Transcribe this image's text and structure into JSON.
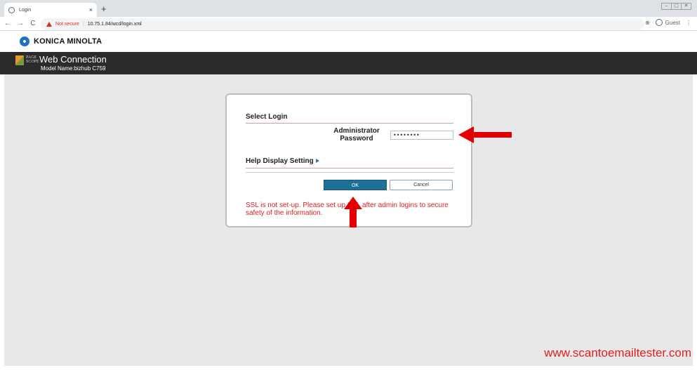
{
  "browser": {
    "tab_title": "Login",
    "tab_close": "×",
    "new_tab": "+",
    "nav": {
      "back": "←",
      "forward": "→",
      "reload": "C"
    },
    "not_secure": "Not secure",
    "separator": "|",
    "url": "10.75.1.84/wcd/login.xml",
    "zoom_icon": "⊕",
    "profile_label": "Guest",
    "menu_icon": "⋮",
    "window_controls": [
      "–",
      "▢",
      "✕"
    ]
  },
  "brand": {
    "company": "KONICA MINOLTA",
    "ps_line1": "PAGE",
    "ps_line2": "SCOPE",
    "product": "Web Connection",
    "model": "Model Name:bizhub C759"
  },
  "login": {
    "select_login_title": "Select Login",
    "admin_label": "Administrator Password",
    "password_value": "••••••••",
    "help_title": "Help Display Setting",
    "ok_label": "OK",
    "cancel_label": "Cancel",
    "ssl_message": "SSL is not set-up. Please set up SSL after admin logins to secure safety of the information."
  },
  "watermark": "www.scantoemailtester.com",
  "colors": {
    "header_bg": "#2b2b2b",
    "ok_button": "#1d7199",
    "warning_red": "#e11e1e",
    "annotation_arrow": "#e40000"
  }
}
